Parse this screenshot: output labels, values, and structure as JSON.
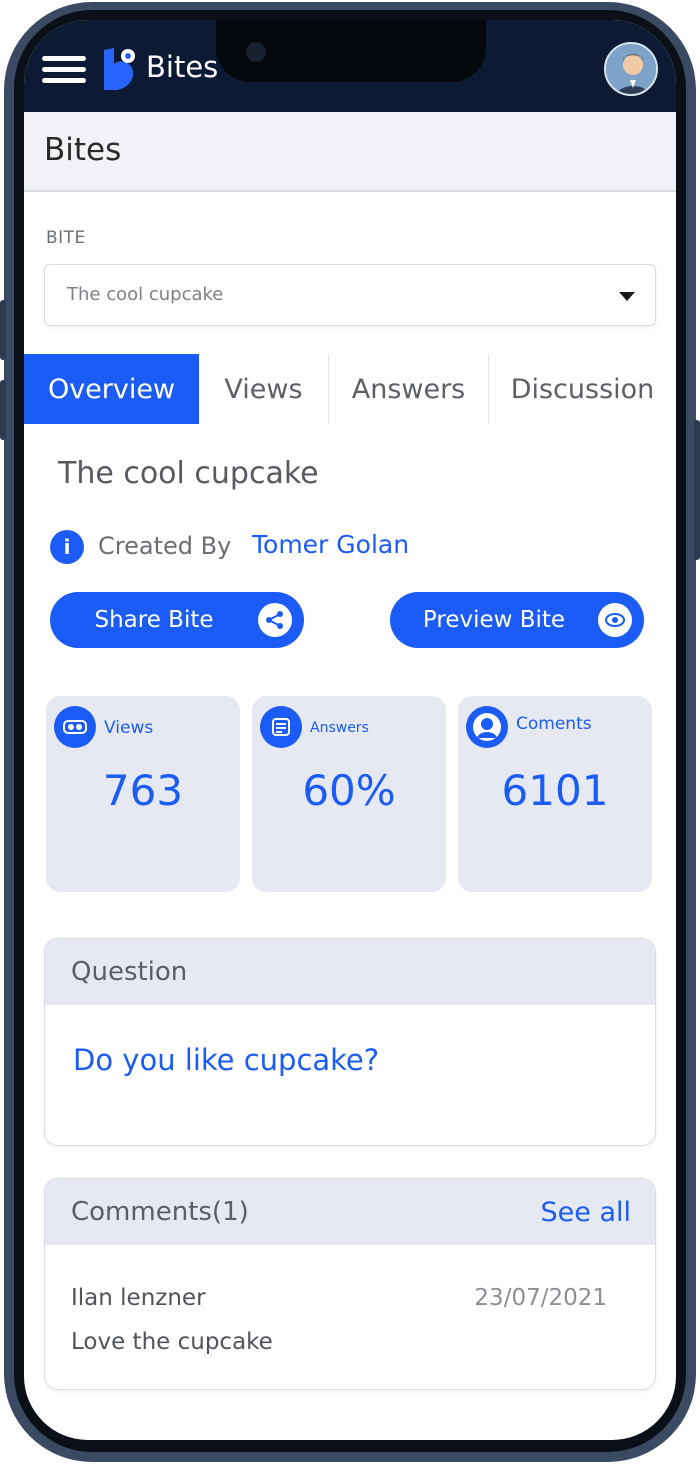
{
  "header": {
    "brand": "Bites"
  },
  "title_bar": {
    "title": "Bites"
  },
  "bite_field": {
    "label": "BITE",
    "selected": "The cool cupcake"
  },
  "tabs": [
    {
      "label": "Overview",
      "active": true
    },
    {
      "label": "Views",
      "active": false
    },
    {
      "label": "Answers",
      "active": false
    },
    {
      "label": "Discussion",
      "active": false
    }
  ],
  "overview": {
    "bite_title": "The cool cupcake",
    "created_by_label": "Created By",
    "creator": "Tomer Golan",
    "share_button": "Share Bite",
    "preview_button": "Preview Bite"
  },
  "stats": [
    {
      "label": "Views",
      "value": "763",
      "icon": "views-icon"
    },
    {
      "label": "Answers",
      "value": "60%",
      "icon": "answers-icon"
    },
    {
      "label": "Coments",
      "value": "6101",
      "icon": "user-icon"
    }
  ],
  "question": {
    "heading": "Question",
    "text": "Do you like cupcake?"
  },
  "comments": {
    "heading": "Comments(1)",
    "see_all": "See all",
    "items": [
      {
        "author": "Ilan lenzner",
        "date": "23/07/2021",
        "text": "Love the cupcake"
      }
    ]
  },
  "colors": {
    "accent": "#1a5cf5",
    "header_bg": "#0d1a33",
    "card_bg": "#e6e9f1"
  }
}
